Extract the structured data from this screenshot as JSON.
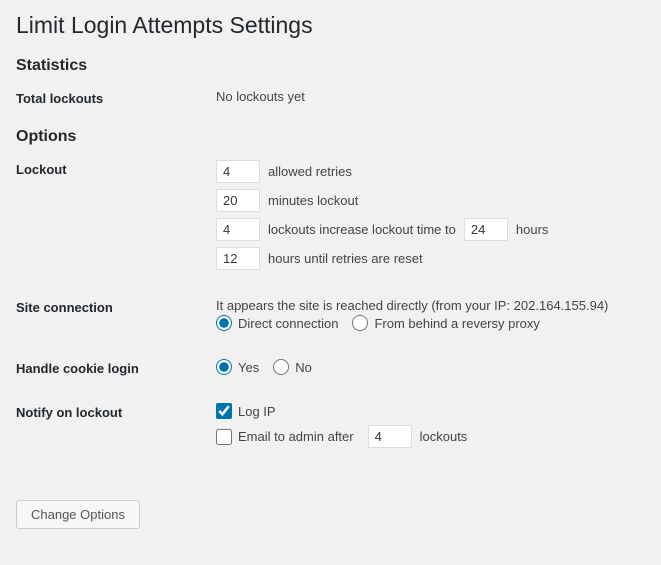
{
  "title": "Limit Login Attempts Settings",
  "stats": {
    "heading": "Statistics",
    "total_lockouts_label": "Total lockouts",
    "total_lockouts_value": "No lockouts yet"
  },
  "options": {
    "heading": "Options",
    "lockout": {
      "label": "Lockout",
      "allowed_retries_value": "4",
      "allowed_retries_text": "allowed retries",
      "minutes_lockout_value": "20",
      "minutes_lockout_text": "minutes lockout",
      "lockouts_increase_value": "4",
      "lockouts_increase_text1": "lockouts increase lockout time to",
      "lockouts_increase_hours": "24",
      "lockouts_increase_text2": "hours",
      "reset_hours_value": "12",
      "reset_hours_text": "hours until retries are reset"
    },
    "site_connection": {
      "label": "Site connection",
      "description": "It appears the site is reached directly (from your IP: 202.164.155.94)",
      "direct_label": "Direct connection",
      "proxy_label": "From behind a reversy proxy",
      "selected": "direct"
    },
    "cookie_login": {
      "label": "Handle cookie login",
      "yes_label": "Yes",
      "no_label": "No",
      "selected": "yes"
    },
    "notify": {
      "label": "Notify on lockout",
      "log_ip_label": "Log IP",
      "log_ip_checked": true,
      "email_label_1": "Email to admin after",
      "email_value": "4",
      "email_label_2": "lockouts",
      "email_checked": false
    }
  },
  "submit": {
    "label": "Change Options"
  }
}
